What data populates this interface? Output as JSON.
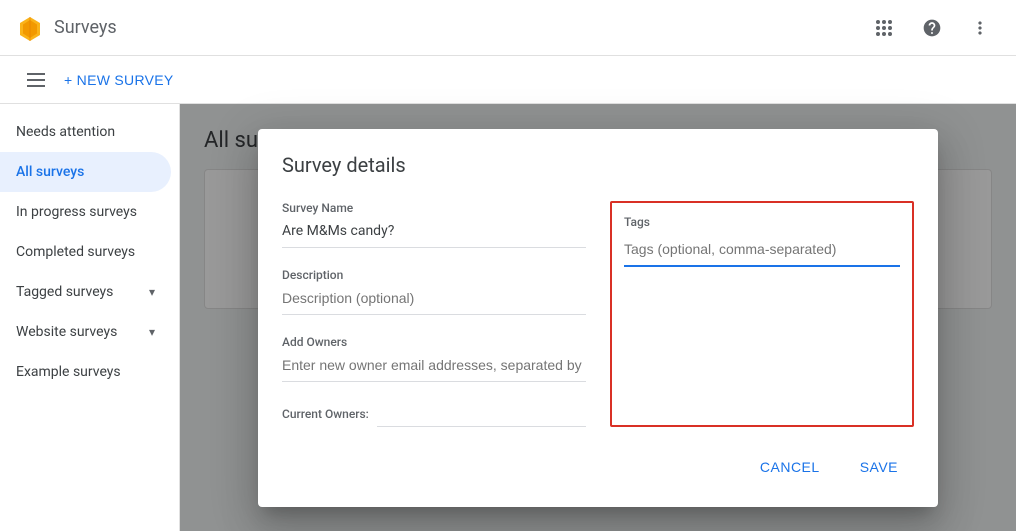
{
  "header": {
    "app_title": "Surveys",
    "grid_icon_label": "apps",
    "help_icon_label": "help",
    "more_icon_label": "more"
  },
  "subheader": {
    "menu_icon_label": "menu",
    "new_survey_label": "+ NEW SURVEY"
  },
  "sidebar": {
    "items": [
      {
        "id": "needs-attention",
        "label": "Needs attention",
        "active": false,
        "has_chevron": false
      },
      {
        "id": "all-surveys",
        "label": "All surveys",
        "active": true,
        "has_chevron": false
      },
      {
        "id": "in-progress",
        "label": "In progress surveys",
        "active": false,
        "has_chevron": false
      },
      {
        "id": "completed",
        "label": "Completed surveys",
        "active": false,
        "has_chevron": false
      },
      {
        "id": "tagged",
        "label": "Tagged surveys",
        "active": false,
        "has_chevron": true
      },
      {
        "id": "website",
        "label": "Website surveys",
        "active": false,
        "has_chevron": true
      },
      {
        "id": "example",
        "label": "Example surveys",
        "active": false,
        "has_chevron": false
      }
    ]
  },
  "content": {
    "title": "All surveys"
  },
  "dialog": {
    "title": "Survey details",
    "survey_name_label": "Survey Name",
    "survey_name_value": "Are M&Ms candy?",
    "description_label": "Description",
    "description_placeholder": "Description (optional)",
    "add_owners_label": "Add Owners",
    "add_owners_placeholder": "Enter new owner email addresses, separated by commas.",
    "current_owners_label": "Current Owners:",
    "tags_label": "Tags",
    "tags_placeholder": "Tags (optional, comma-separated)",
    "cancel_label": "CANCEL",
    "save_label": "SAVE"
  }
}
